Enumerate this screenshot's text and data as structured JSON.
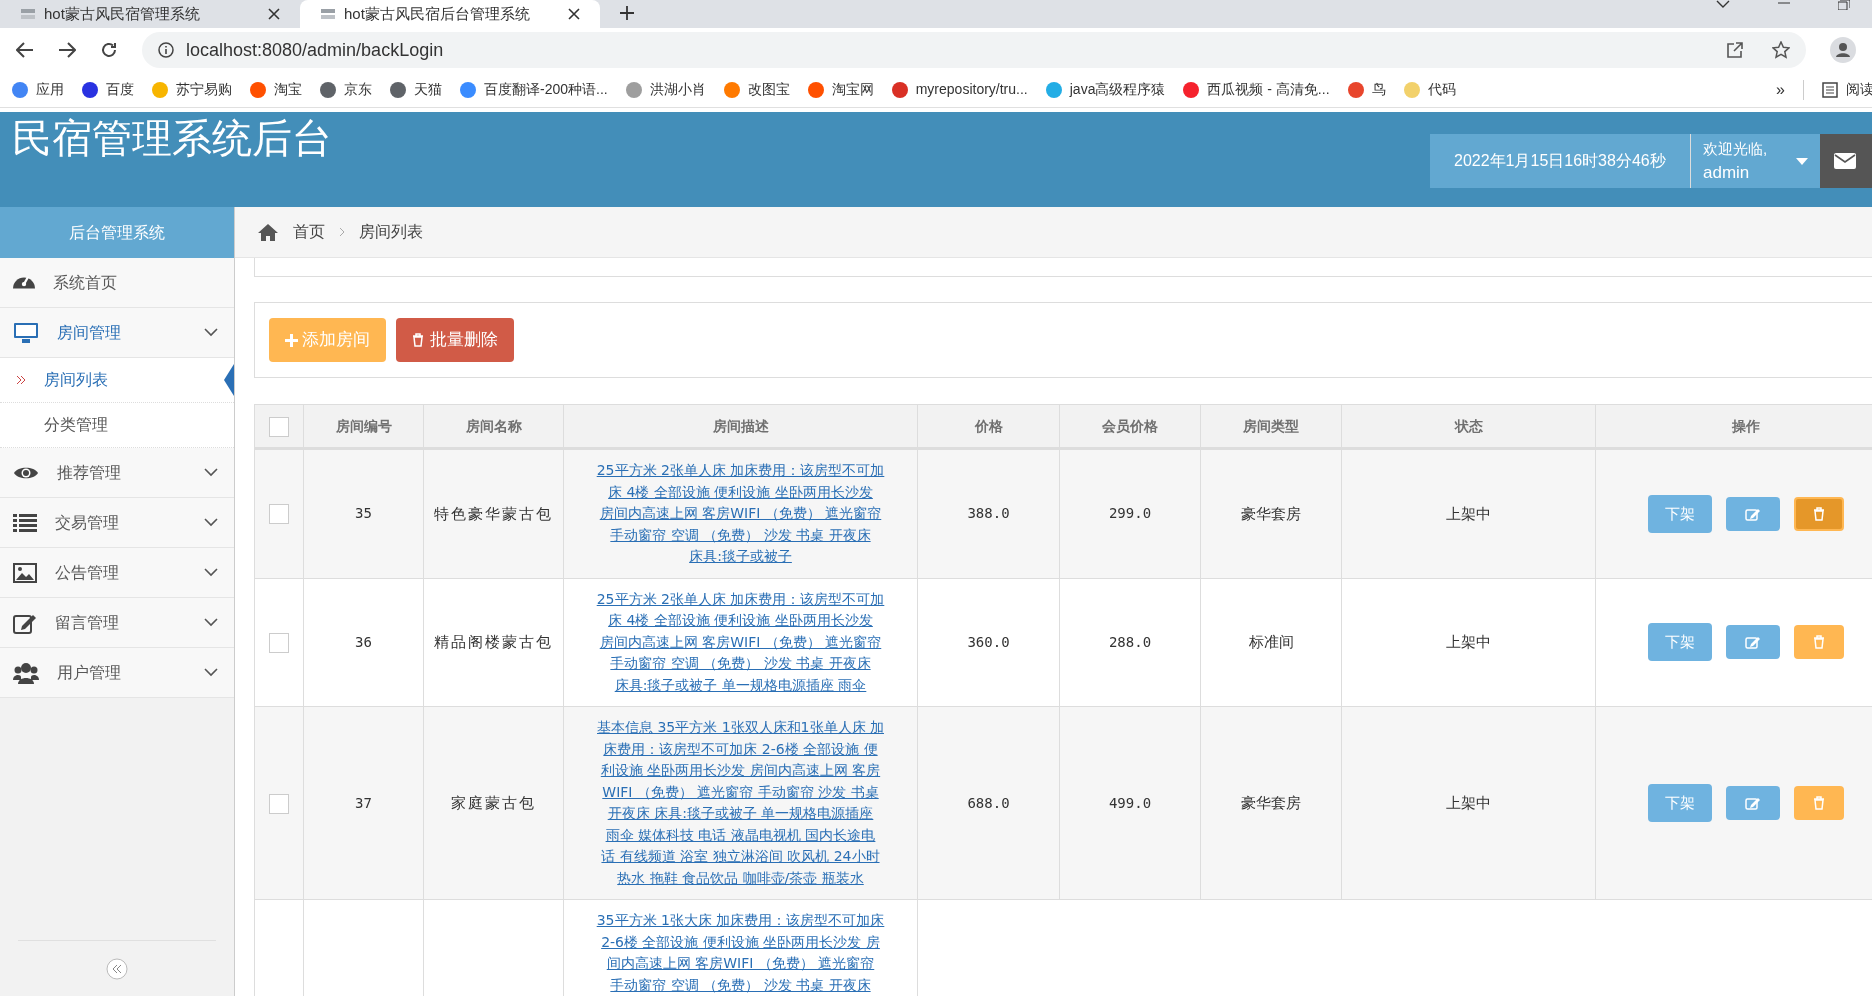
{
  "browser": {
    "tabs": [
      {
        "label": "hot蒙古风民宿管理系统",
        "selected": false
      },
      {
        "label": "hot蒙古风民宿后台管理系统",
        "selected": true
      }
    ],
    "url": "localhost:8080/admin/backLogin",
    "bookmarks": [
      {
        "label": "应用",
        "color": "#4285f4"
      },
      {
        "label": "百度",
        "color": "#2932e1"
      },
      {
        "label": "苏宁易购",
        "color": "#f7b500"
      },
      {
        "label": "淘宝",
        "color": "#ff5000"
      },
      {
        "label": "京东",
        "color": "#5f6368"
      },
      {
        "label": "天猫",
        "color": "#5f6368"
      },
      {
        "label": "百度翻译-200种语...",
        "color": "#3a8cff"
      },
      {
        "label": "洪湖小肖",
        "color": "#9e9e9e"
      },
      {
        "label": "改图宝",
        "color": "#ff7a00"
      },
      {
        "label": "淘宝网",
        "color": "#ff5000"
      },
      {
        "label": "myrepository/tru...",
        "color": "#d93025"
      },
      {
        "label": "java高级程序猿",
        "color": "#23ade5"
      },
      {
        "label": "西瓜视频 - 高清免...",
        "color": "#f5222d"
      },
      {
        "label": "鸟",
        "color": "#e8452c"
      },
      {
        "label": "代码",
        "color": "#f2d16b"
      }
    ],
    "more": "»",
    "reading_list": "阅读"
  },
  "header": {
    "title": "民宿管理系统后台",
    "datetime": "2022年1月15日16时38分46秒",
    "welcome": "欢迎光临,",
    "user": "admin"
  },
  "sidebar": {
    "title": "后台管理系统",
    "items": [
      {
        "label": "系统首页",
        "kind": "dashboard",
        "expanded": false
      },
      {
        "label": "房间管理",
        "kind": "desktop",
        "expanded": true,
        "has_caret": true,
        "children": [
          {
            "label": "房间列表",
            "selected": true
          },
          {
            "label": "分类管理",
            "selected": false
          }
        ]
      },
      {
        "label": "推荐管理",
        "kind": "eye",
        "expanded": false,
        "has_caret": true
      },
      {
        "label": "交易管理",
        "kind": "list",
        "expanded": false,
        "has_caret": true
      },
      {
        "label": "公告管理",
        "kind": "picture",
        "expanded": false,
        "has_caret": true
      },
      {
        "label": "留言管理",
        "kind": "edit",
        "expanded": false,
        "has_caret": true
      },
      {
        "label": "用户管理",
        "kind": "users",
        "expanded": false,
        "has_caret": true
      }
    ]
  },
  "breadcrumb": [
    "首页",
    "房间列表"
  ],
  "toolbar": {
    "add": "添加房间",
    "batch_delete": "批量删除"
  },
  "table": {
    "columns": [
      "房间编号",
      "房间名称",
      "房间描述",
      "价格",
      "会员价格",
      "房间类型",
      "状态",
      "操作"
    ],
    "select_all": false,
    "rows": [
      {
        "checked": false,
        "id": "35",
        "name": "特色豪华蒙古包",
        "description": [
          "25平方米 2张单人床 加床费用：该房型不可加",
          "床 4楼 全部设施 便利设施 坐卧两用长沙发",
          "房间内高速上网 客房WIFI （免费） 遮光窗帘",
          "手动窗帘 空调 （免费） 沙发 书桌 开夜床",
          "床具:毯子或被子"
        ],
        "price": "388.0",
        "member_price": "299.0",
        "type": "豪华套房",
        "status": "上架中",
        "action": "下架",
        "delete_hovered": true
      },
      {
        "checked": false,
        "id": "36",
        "name": "精品阁楼蒙古包",
        "description": [
          "25平方米 2张单人床 加床费用：该房型不可加",
          "床 4楼 全部设施 便利设施 坐卧两用长沙发",
          "房间内高速上网 客房WIFI （免费） 遮光窗帘",
          "手动窗帘 空调 （免费） 沙发 书桌 开夜床",
          "床具:毯子或被子 单一规格电源插座 雨伞"
        ],
        "price": "360.0",
        "member_price": "288.0",
        "type": "标准间",
        "status": "上架中",
        "action": "下架",
        "delete_hovered": false
      },
      {
        "checked": false,
        "id": "37",
        "name": "家庭蒙古包",
        "description": [
          "基本信息 35平方米 1张双人床和1张单人床 加",
          "床费用：该房型不可加床 2-6楼 全部设施 便",
          "利设施 坐卧两用长沙发 房间内高速上网 客房",
          "WIFI （免费） 遮光窗帘 手动窗帘 沙发 书桌",
          "开夜床 床具:毯子或被子 单一规格电源插座",
          "雨伞 媒体科技 电话 液晶电视机 国内长途电",
          "话 有线频道 浴室 独立淋浴间 吹风机 24小时",
          "热水 拖鞋 食品饮品 咖啡壶/茶壶 瓶装水"
        ],
        "price": "688.0",
        "member_price": "499.0",
        "type": "豪华套房",
        "status": "上架中",
        "action": "下架",
        "delete_hovered": false
      },
      {
        "description": [
          "35平方米 1张大床 加床费用：该房型不可加床",
          "2-6楼 全部设施 便利设施 坐卧两用长沙发 房",
          "间内高速上网 客房WIFI （免费） 遮光窗帘",
          "手动窗帘 空调 （免费） 沙发 书桌 开夜床"
        ]
      }
    ]
  }
}
